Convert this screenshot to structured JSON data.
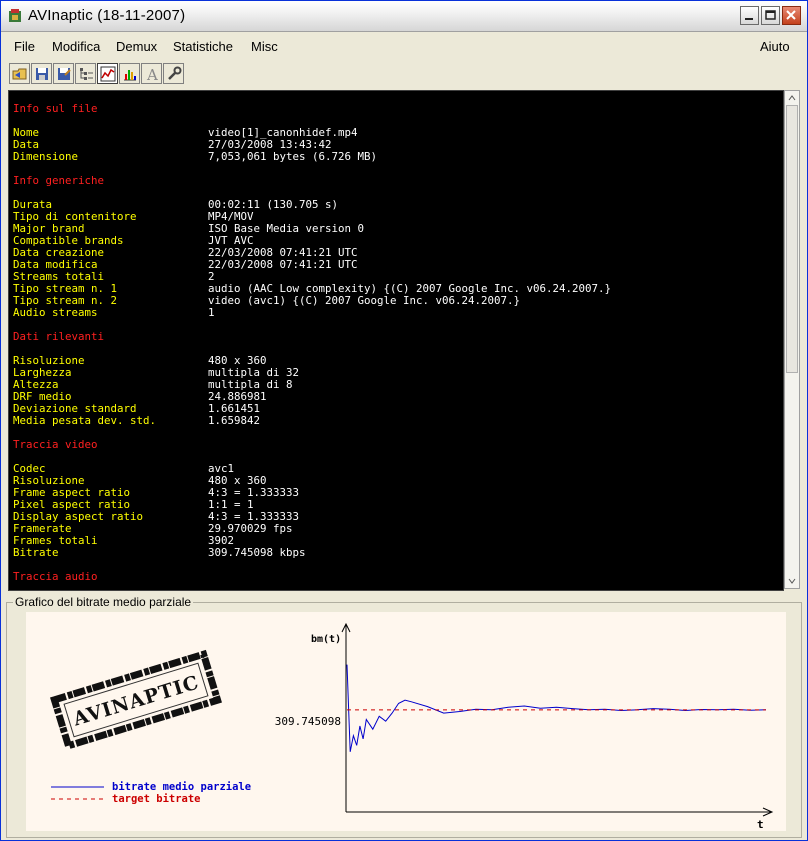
{
  "window": {
    "title": "AVInaptic (18-11-2007)"
  },
  "menu": {
    "items": [
      "File",
      "Modifica",
      "Demux",
      "Statistiche",
      "Misc"
    ],
    "help": "Aiuto"
  },
  "toolbar": {
    "icons": [
      "open-icon",
      "save-icon",
      "save-as-icon",
      "tree-view-icon",
      "graph-icon",
      "chart-icon",
      "font-icon",
      "tools-icon"
    ]
  },
  "report": {
    "sections": [
      {
        "title": "Info sul file",
        "rows": [
          [
            "Nome",
            "video[1]_canonhidef.mp4"
          ],
          [
            "Data",
            "27/03/2008 13:43:42"
          ],
          [
            "Dimensione",
            "7,053,061 bytes (6.726 MB)"
          ]
        ]
      },
      {
        "title": "Info generiche",
        "rows": [
          [
            "Durata",
            "00:02:11 (130.705 s)"
          ],
          [
            "Tipo di contenitore",
            "MP4/MOV"
          ],
          [
            "Major brand",
            "ISO Base Media version 0"
          ],
          [
            "Compatible brands",
            "JVT AVC"
          ],
          [
            "Data creazione",
            "22/03/2008 07:41:21 UTC"
          ],
          [
            "Data modifica",
            "22/03/2008 07:41:21 UTC"
          ],
          [
            "Streams totali",
            "2"
          ],
          [
            "Tipo stream n. 1",
            "audio (AAC Low complexity) {(C) 2007 Google Inc. v06.24.2007.}"
          ],
          [
            "Tipo stream n. 2",
            "video (avc1) {(C) 2007 Google Inc. v06.24.2007.}"
          ],
          [
            "Audio streams",
            "1"
          ]
        ]
      },
      {
        "title": "Dati rilevanti",
        "rows": [
          [
            "Risoluzione",
            "480 x 360"
          ],
          [
            "Larghezza",
            "multipla di 32"
          ],
          [
            "Altezza",
            "multipla di 8"
          ],
          [
            "DRF medio",
            "24.886981"
          ],
          [
            "Deviazione standard",
            "1.661451"
          ],
          [
            "Media pesata dev. std.",
            "1.659842"
          ]
        ]
      },
      {
        "title": "Traccia video",
        "rows": [
          [
            "Codec",
            "avc1"
          ],
          [
            "Risoluzione",
            "480 x 360"
          ],
          [
            "Frame aspect ratio",
            "4:3 = 1.333333"
          ],
          [
            "Pixel aspect ratio",
            "1:1 = 1"
          ],
          [
            "Display aspect ratio",
            "4:3 = 1.333333"
          ],
          [
            "Framerate",
            "29.970029 fps"
          ],
          [
            "Frames totali",
            "3902"
          ],
          [
            "Bitrate",
            "309.745098 kbps"
          ]
        ]
      },
      {
        "title": "Traccia audio",
        "rows": []
      }
    ]
  },
  "graph": {
    "group_title": "Grafico del bitrate medio parziale",
    "stamp_text": "AVINAPTIC",
    "y_axis_label": "bm(t)",
    "x_axis_label": "t",
    "target_label": "309.745098",
    "legend": {
      "series": "bitrate medio parziale",
      "target": "target bitrate"
    },
    "colors": {
      "series": "#0000cc",
      "target": "#cc0000"
    }
  },
  "chart_data": {
    "type": "line",
    "xlabel": "t",
    "ylabel": "bm(t)",
    "series": [
      {
        "name": "bitrate medio parziale",
        "x": [
          0,
          1,
          2,
          3,
          4,
          5,
          6,
          8,
          10,
          12,
          14,
          16,
          18,
          20,
          25,
          30,
          35,
          40,
          45,
          50,
          55,
          60,
          65,
          70,
          75,
          80,
          85,
          90,
          95,
          100,
          105,
          110,
          115,
          120,
          125,
          130
        ],
        "y": [
          450,
          180,
          230,
          200,
          260,
          220,
          280,
          250,
          290,
          275,
          300,
          330,
          340,
          335,
          320,
          300,
          305,
          312,
          310,
          318,
          322,
          315,
          318,
          314,
          310,
          312,
          308,
          310,
          314,
          312,
          308,
          311,
          310,
          312,
          309,
          310
        ]
      },
      {
        "name": "target bitrate",
        "x": [
          0,
          130
        ],
        "y": [
          309.745098,
          309.745098
        ]
      }
    ]
  }
}
